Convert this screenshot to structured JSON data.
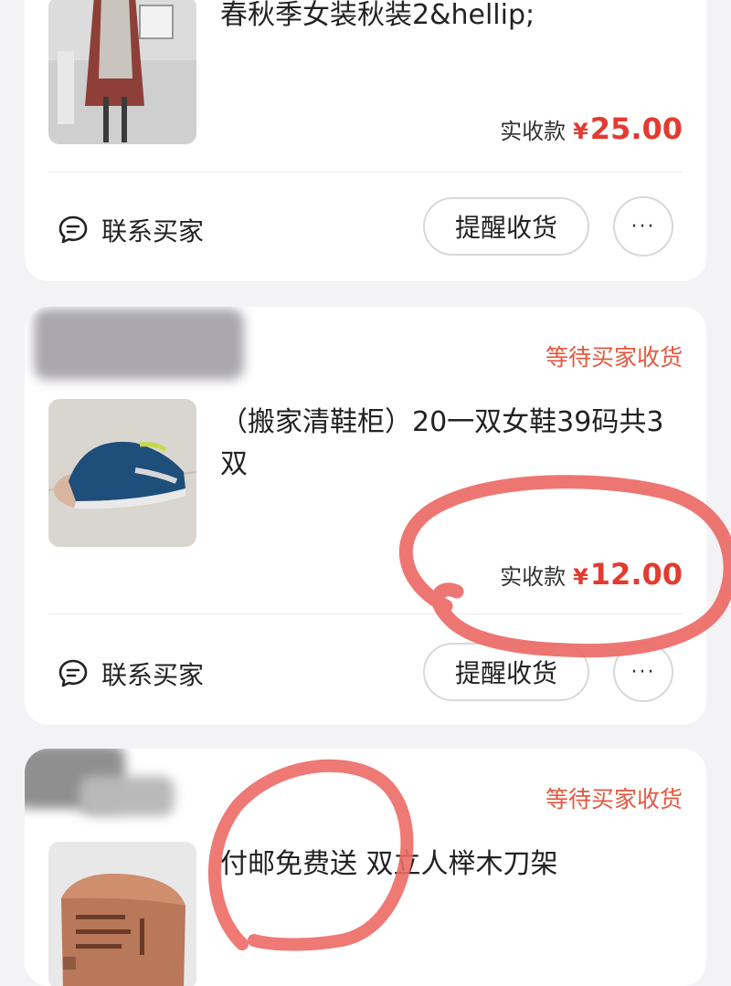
{
  "orders": [
    {
      "title": "春秋季女装秋装2&hellip;",
      "price_label": "实收款",
      "currency": "¥",
      "amount": "25.00",
      "contact_label": "联系买家",
      "remind_label": "提醒收货",
      "more_label": "···"
    },
    {
      "status": "等待买家收货",
      "title": "（搬家清鞋柜）20一双女鞋39码共3双",
      "price_label": "实收款",
      "currency": "¥",
      "amount": "12.00",
      "contact_label": "联系买家",
      "remind_label": "提醒收货",
      "more_label": "···"
    },
    {
      "status": "等待买家收货",
      "title": "付邮免费送 双立人榉木刀架"
    }
  ],
  "colors": {
    "status": "#e4573f",
    "price": "#e33b30",
    "annotation": "#ec6a66"
  }
}
